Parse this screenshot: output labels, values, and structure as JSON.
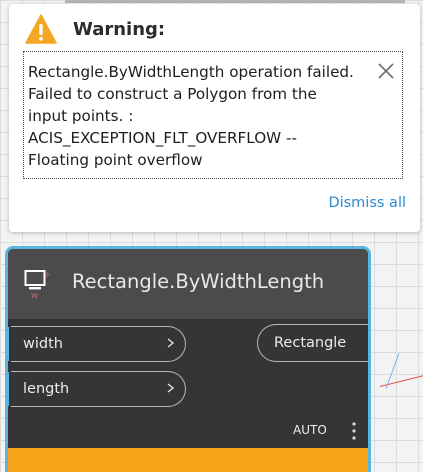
{
  "warning": {
    "title": "Warning:",
    "message_lines": [
      "Rectangle.ByWidthLength operation failed.",
      "Failed to construct a Polygon from the",
      "input points. :",
      "ACIS_EXCEPTION_FLT_OVERFLOW --",
      "Floating point overflow"
    ],
    "dismiss_label": "Dismiss all",
    "icon": "warning-triangle-icon",
    "icon_color": "#f5a623",
    "link_color": "#2b8bd0"
  },
  "node": {
    "title": "Rectangle.ByWidthLength",
    "icon": "rectangle-node-icon",
    "inputs": [
      {
        "label": "width",
        "chevron": ">"
      },
      {
        "label": "length",
        "chevron": ">"
      }
    ],
    "output": {
      "label": "Rectangle"
    },
    "lacing": "AUTO",
    "accent_color": "#5bb5e0",
    "warning_color": "#f7a41b"
  }
}
